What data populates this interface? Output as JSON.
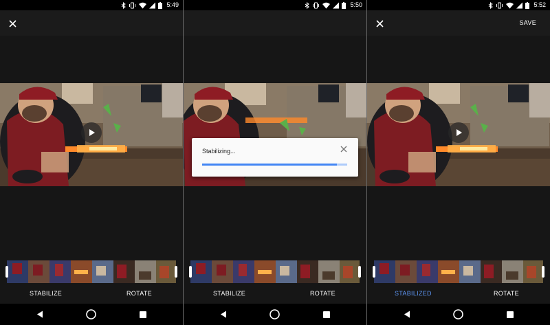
{
  "panels": [
    {
      "status": {
        "time": "5:49"
      },
      "toolbar": {
        "save_label": ""
      },
      "actions": {
        "stabilize_label": "STABILIZE",
        "rotate_label": "ROTATE"
      }
    },
    {
      "status": {
        "time": "5:50"
      },
      "toolbar": {
        "save_label": ""
      },
      "actions": {
        "stabilize_label": "STABILIZE",
        "rotate_label": "ROTATE"
      },
      "dialog": {
        "title": "Stabilizing...",
        "progress_fraction": 0.93
      }
    },
    {
      "status": {
        "time": "5:52"
      },
      "toolbar": {
        "save_label": "SAVE"
      },
      "actions": {
        "stabilize_label": "STABILIZED",
        "rotate_label": "ROTATE"
      }
    }
  ],
  "icons": {
    "close": "close-icon",
    "play": "play-icon",
    "nav_back": "back-triangle-icon",
    "nav_home": "home-circle-icon",
    "nav_recent": "recent-apps-square-icon",
    "status": [
      "bluetooth-icon",
      "vibrate-icon",
      "wifi-icon",
      "cell-signal-icon",
      "battery-icon"
    ]
  },
  "colors": {
    "accent": "#5e97f6",
    "progress": "#4285f4",
    "background": "#161616"
  }
}
